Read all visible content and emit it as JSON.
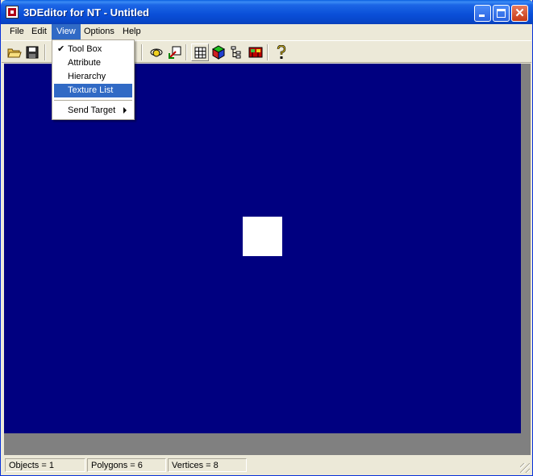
{
  "window": {
    "title": "3DEditor for NT - Untitled"
  },
  "menubar": {
    "items": [
      "File",
      "Edit",
      "View",
      "Options",
      "Help"
    ],
    "active": "View"
  },
  "view_menu": {
    "items": [
      {
        "label": "Tool Box",
        "checked": true
      },
      {
        "label": "Attribute",
        "checked": false
      },
      {
        "label": "Hierarchy",
        "checked": false
      },
      {
        "label": "Texture List",
        "checked": false,
        "highlighted": true
      },
      {
        "label": "Send Target",
        "submenu": true
      }
    ]
  },
  "toolbar": {
    "icons": [
      "open-folder-icon",
      "save-icon",
      "orbit-icon",
      "transform-icon",
      "grid-icon",
      "cube-color-icon",
      "hierarchy-icon",
      "texture-list-icon",
      "help-icon"
    ]
  },
  "status": {
    "objects": "Objects = 1",
    "polygons": "Polygons = 6",
    "vertices": "Vertices = 8"
  },
  "colors": {
    "viewport_background": "#000080",
    "selection": "#316ac5"
  }
}
